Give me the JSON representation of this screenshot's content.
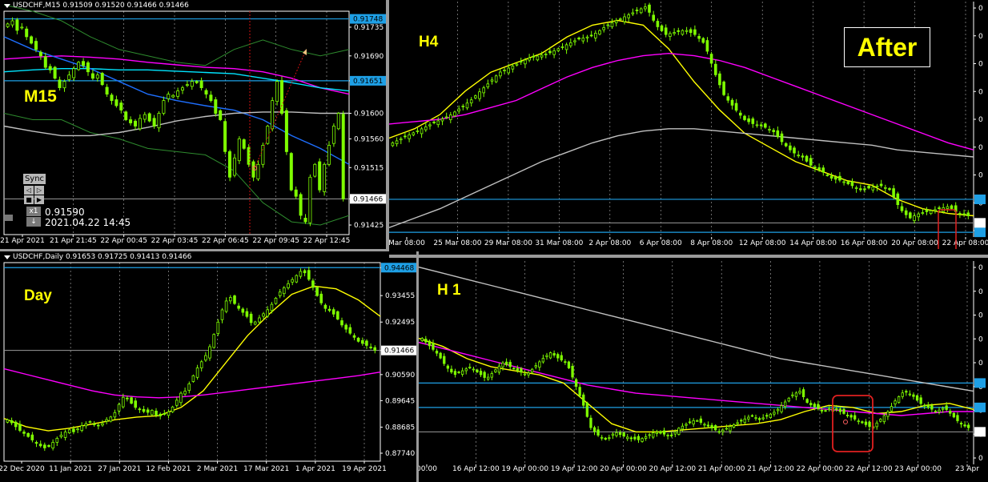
{
  "colors": {
    "candle": "#7fff00",
    "ma_yellow": "#ffff00",
    "ma_magenta": "#ff00ff",
    "ma_grey": "#c0c0c0",
    "ma_blue": "#1e6fff",
    "ma_cyan": "#00e5ff",
    "bollinger": "#2e8b2e",
    "hline": "#1ea0e6",
    "price_hline": "#9a9a9a",
    "grid": "#ffffff",
    "highlight_box": "#e02020"
  },
  "after_label": "After",
  "chart_data": [
    {
      "type": "candlestick",
      "panel_label": "M15",
      "header": "USDCHF,M15  0.91509 0.91520 0.91466 0.91466",
      "y_ticks": [
        "0.91735",
        "0.91690",
        "0.91651",
        "0.91600",
        "0.91560",
        "0.91515",
        "0.91466",
        "0.91425"
      ],
      "ylim": [
        0.9141,
        0.9176
      ],
      "price_labels": [
        {
          "text": "0.91748",
          "value": 0.91748,
          "style": "hline"
        },
        {
          "text": "0.91651",
          "value": 0.91651,
          "style": "hline"
        },
        {
          "text": "0.91466",
          "value": 0.91466,
          "style": "current"
        }
      ],
      "x_ticks": [
        "21 Apr 2021",
        "21 Apr 21:45",
        "22 Apr 00:45",
        "22 Apr 03:45",
        "22 Apr 06:45",
        "22 Apr 09:45",
        "22 Apr 12:45"
      ],
      "close": [
        0.9174,
        0.91745,
        0.9173,
        0.91735,
        0.9172,
        0.9171,
        0.917,
        0.9169,
        0.91672,
        0.91668,
        0.91655,
        0.9164,
        0.9165,
        0.9166,
        0.9167,
        0.9168,
        0.91675,
        0.91665,
        0.91655,
        0.9166,
        0.91645,
        0.9163,
        0.9162,
        0.91612,
        0.91605,
        0.9159,
        0.91585,
        0.9158,
        0.91592,
        0.91598,
        0.91588,
        0.9158,
        0.916,
        0.9162,
        0.9163,
        0.91628,
        0.91635,
        0.9164,
        0.91645,
        0.9165,
        0.91648,
        0.9164,
        0.9163,
        0.9162,
        0.916,
        0.9159,
        0.9154,
        0.915,
        0.9153,
        0.9156,
        0.91545,
        0.9152,
        0.915,
        0.9152,
        0.9155,
        0.9158,
        0.9162,
        0.9165,
        0.916,
        0.9154,
        0.9148,
        0.9147,
        0.9144,
        0.9143,
        0.915,
        0.9152,
        0.9148,
        0.9152,
        0.9155,
        0.9158,
        0.916,
        0.91466
      ],
      "ma": [
        {
          "color": "ma_magenta",
          "values": [
            0.91685,
            0.91688,
            0.9169,
            0.91688,
            0.91685,
            0.9168,
            0.91676,
            0.91672,
            0.9167,
            0.91665,
            0.91655,
            0.9164,
            0.9163
          ]
        },
        {
          "color": "ma_cyan",
          "values": [
            0.91665,
            0.91668,
            0.9167,
            0.9167,
            0.91668,
            0.91668,
            0.91666,
            0.91664,
            0.91662,
            0.91655,
            0.91648,
            0.9164,
            0.91635
          ]
        },
        {
          "color": "ma_blue",
          "values": [
            0.9172,
            0.917,
            0.91685,
            0.9167,
            0.9165,
            0.9163,
            0.9162,
            0.91612,
            0.91605,
            0.9159,
            0.91565,
            0.91545,
            0.9152
          ]
        },
        {
          "color": "ma_grey",
          "values": [
            0.9158,
            0.91572,
            0.91565,
            0.91565,
            0.9157,
            0.91578,
            0.91588,
            0.91595,
            0.916,
            0.91602,
            0.91602,
            0.916,
            0.916
          ]
        }
      ],
      "bollinger": {
        "upper": [
          0.9177,
          0.9176,
          0.91745,
          0.9172,
          0.917,
          0.9169,
          0.9168,
          0.91675,
          0.917,
          0.91715,
          0.917,
          0.9169,
          0.917
        ],
        "lower": [
          0.916,
          0.9159,
          0.9159,
          0.9157,
          0.9156,
          0.91545,
          0.9154,
          0.91535,
          0.9151,
          0.9146,
          0.9143,
          0.91425,
          0.9144
        ]
      },
      "sync": {
        "label": "Sync",
        "x1": "x1",
        "price": "0.91590",
        "datetime": "2021.04.22 14:45"
      }
    },
    {
      "type": "candlestick",
      "panel_label": "H4",
      "x_ticks": [
        "Mar 08:00",
        "25 Mar 08:00",
        "29 Mar 08:00",
        "31 Mar 08:00",
        "2 Apr 08:00",
        "6 Apr 08:00",
        "8 Apr 08:00",
        "12 Apr 08:00",
        "14 Apr 08:00",
        "16 Apr 08:00",
        "20 Apr 08:00",
        "22 Apr 08:00"
      ],
      "ylim": [
        0,
        1
      ],
      "close": [
        0.4,
        0.42,
        0.44,
        0.46,
        0.48,
        0.5,
        0.52,
        0.55,
        0.58,
        0.62,
        0.66,
        0.7,
        0.72,
        0.74,
        0.76,
        0.77,
        0.78,
        0.8,
        0.82,
        0.84,
        0.85,
        0.87,
        0.9,
        0.92,
        0.94,
        0.96,
        0.98,
        0.9,
        0.86,
        0.87,
        0.88,
        0.86,
        0.82,
        0.7,
        0.6,
        0.55,
        0.5,
        0.48,
        0.47,
        0.45,
        0.4,
        0.36,
        0.34,
        0.3,
        0.28,
        0.25,
        0.24,
        0.22,
        0.2,
        0.21,
        0.22,
        0.2,
        0.12,
        0.08,
        0.1,
        0.11,
        0.12,
        0.13,
        0.1,
        0.09
      ],
      "ma": [
        {
          "color": "ma_yellow",
          "values": [
            0.42,
            0.46,
            0.52,
            0.62,
            0.7,
            0.74,
            0.78,
            0.85,
            0.9,
            0.92,
            0.9,
            0.8,
            0.66,
            0.54,
            0.44,
            0.38,
            0.32,
            0.28,
            0.24,
            0.22,
            0.16,
            0.12,
            0.1,
            0.09
          ]
        },
        {
          "color": "ma_magenta",
          "values": [
            0.48,
            0.49,
            0.5,
            0.52,
            0.55,
            0.58,
            0.63,
            0.68,
            0.72,
            0.75,
            0.77,
            0.78,
            0.77,
            0.75,
            0.72,
            0.68,
            0.64,
            0.6,
            0.56,
            0.52,
            0.48,
            0.44,
            0.4,
            0.37
          ]
        },
        {
          "color": "ma_grey",
          "values": [
            0.04,
            0.08,
            0.12,
            0.17,
            0.22,
            0.27,
            0.32,
            0.36,
            0.4,
            0.43,
            0.45,
            0.46,
            0.46,
            0.45,
            0.44,
            0.43,
            0.42,
            0.41,
            0.4,
            0.39,
            0.37,
            0.36,
            0.35,
            0.34
          ]
        }
      ],
      "hlines": [
        0.16,
        0.02
      ],
      "price_hline": 0.06
    },
    {
      "type": "candlestick",
      "panel_label": "Day",
      "header": "USDCHF,Daily  0.91653 0.91725 0.91413 0.91466",
      "y_ticks": [
        "0.94468",
        "0.93455",
        "0.92495",
        "0.91466",
        "0.90590",
        "0.89645",
        "0.88685",
        "0.87740"
      ],
      "ylim": [
        0.8745,
        0.9465
      ],
      "price_labels": [
        {
          "text": "0.94468",
          "value": 0.94468,
          "style": "hline"
        },
        {
          "text": "0.91466",
          "value": 0.91466,
          "style": "current"
        }
      ],
      "x_ticks": [
        "22 Dec 2020",
        "11 Jan 2021",
        "27 Jan 2021",
        "12 Feb 2021",
        "2 Mar 2021",
        "17 Mar 2021",
        "1 Apr 2021",
        "19 Apr 2021"
      ],
      "close": [
        0.8895,
        0.888,
        0.886,
        0.8845,
        0.883,
        0.8812,
        0.88,
        0.879,
        0.881,
        0.883,
        0.8845,
        0.886,
        0.885,
        0.887,
        0.888,
        0.889,
        0.887,
        0.888,
        0.89,
        0.891,
        0.895,
        0.8985,
        0.896,
        0.894,
        0.893,
        0.892,
        0.893,
        0.8905,
        0.8915,
        0.8925,
        0.895,
        0.899,
        0.9,
        0.904,
        0.908,
        0.911,
        0.914,
        0.92,
        0.926,
        0.932,
        0.934,
        0.931,
        0.929,
        0.927,
        0.924,
        0.926,
        0.928,
        0.93,
        0.933,
        0.936,
        0.938,
        0.94,
        0.942,
        0.944,
        0.941,
        0.937,
        0.933,
        0.93,
        0.929,
        0.927,
        0.924,
        0.922,
        0.92,
        0.918,
        0.917,
        0.916,
        0.9147
      ],
      "ma": [
        {
          "color": "ma_yellow",
          "values": [
            0.89,
            0.887,
            0.8855,
            0.8865,
            0.888,
            0.8895,
            0.8905,
            0.891,
            0.894,
            0.9,
            0.91,
            0.92,
            0.928,
            0.935,
            0.938,
            0.937,
            0.933,
            0.927
          ]
        },
        {
          "color": "ma_magenta",
          "values": [
            0.908,
            0.906,
            0.904,
            0.902,
            0.9,
            0.8985,
            0.8978,
            0.8975,
            0.8978,
            0.8985,
            0.8995,
            0.9005,
            0.9015,
            0.9025,
            0.9035,
            0.9045,
            0.9055,
            0.9068
          ]
        }
      ]
    },
    {
      "type": "candlestick",
      "panel_label": "H 1",
      "x_ticks": [
        "00:00",
        "16 Apr 12:00",
        "19 Apr 00:00",
        "19 Apr 12:00",
        "20 Apr 00:00",
        "20 Apr 12:00",
        "21 Apr 00:00",
        "21 Apr 12:00",
        "22 Apr 00:00",
        "22 Apr 12:00",
        "23 Apr 00:00",
        "23 Apr"
      ],
      "ylim": [
        0,
        1
      ],
      "close": [
        0.62,
        0.58,
        0.54,
        0.48,
        0.44,
        0.46,
        0.48,
        0.45,
        0.42,
        0.46,
        0.5,
        0.48,
        0.46,
        0.44,
        0.48,
        0.52,
        0.55,
        0.52,
        0.5,
        0.4,
        0.3,
        0.18,
        0.14,
        0.12,
        0.16,
        0.14,
        0.13,
        0.12,
        0.14,
        0.16,
        0.15,
        0.14,
        0.18,
        0.2,
        0.22,
        0.2,
        0.18,
        0.16,
        0.18,
        0.2,
        0.22,
        0.24,
        0.22,
        0.24,
        0.26,
        0.3,
        0.34,
        0.36,
        0.3,
        0.28,
        0.26,
        0.28,
        0.26,
        0.24,
        0.22,
        0.2,
        0.18,
        0.22,
        0.26,
        0.32,
        0.36,
        0.34,
        0.3,
        0.28,
        0.26,
        0.28,
        0.24,
        0.2,
        0.18
      ],
      "ma": [
        {
          "color": "ma_yellow",
          "values": [
            0.62,
            0.58,
            0.52,
            0.48,
            0.46,
            0.44,
            0.4,
            0.3,
            0.2,
            0.16,
            0.16,
            0.17,
            0.18,
            0.19,
            0.2,
            0.22,
            0.26,
            0.29,
            0.28,
            0.25,
            0.26,
            0.29,
            0.3,
            0.27
          ]
        },
        {
          "color": "ma_magenta",
          "values": [
            0.6,
            0.57,
            0.54,
            0.51,
            0.48,
            0.45,
            0.42,
            0.39,
            0.37,
            0.35,
            0.34,
            0.33,
            0.32,
            0.31,
            0.3,
            0.29,
            0.28,
            0.27,
            0.26,
            0.25,
            0.24,
            0.25,
            0.26,
            0.26
          ]
        },
        {
          "color": "ma_grey",
          "values": [
            0.97,
            0.94,
            0.91,
            0.88,
            0.85,
            0.82,
            0.79,
            0.76,
            0.73,
            0.7,
            0.67,
            0.64,
            0.61,
            0.58,
            0.55,
            0.52,
            0.5,
            0.48,
            0.46,
            0.44,
            0.42,
            0.4,
            0.38,
            0.36
          ]
        }
      ],
      "hlines": [
        0.4,
        0.28
      ],
      "price_hline": 0.16
    }
  ]
}
